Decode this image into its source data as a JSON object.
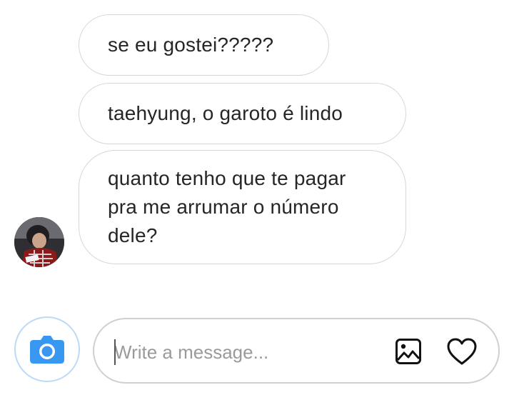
{
  "messages": [
    {
      "text": "se eu gostei?????"
    },
    {
      "text": "taehyung, o garoto é lindo"
    },
    {
      "text": "quanto tenho que te pagar\npra me arrumar o número\ndele?"
    }
  ],
  "composer": {
    "placeholder": "Write a message..."
  },
  "icons": {
    "camera": "camera-icon",
    "gallery": "image-gallery-icon",
    "like": "heart-icon"
  },
  "colors": {
    "camera_blue": "#3897f0",
    "bubble_border": "#d7d7d7",
    "text": "#262626"
  }
}
